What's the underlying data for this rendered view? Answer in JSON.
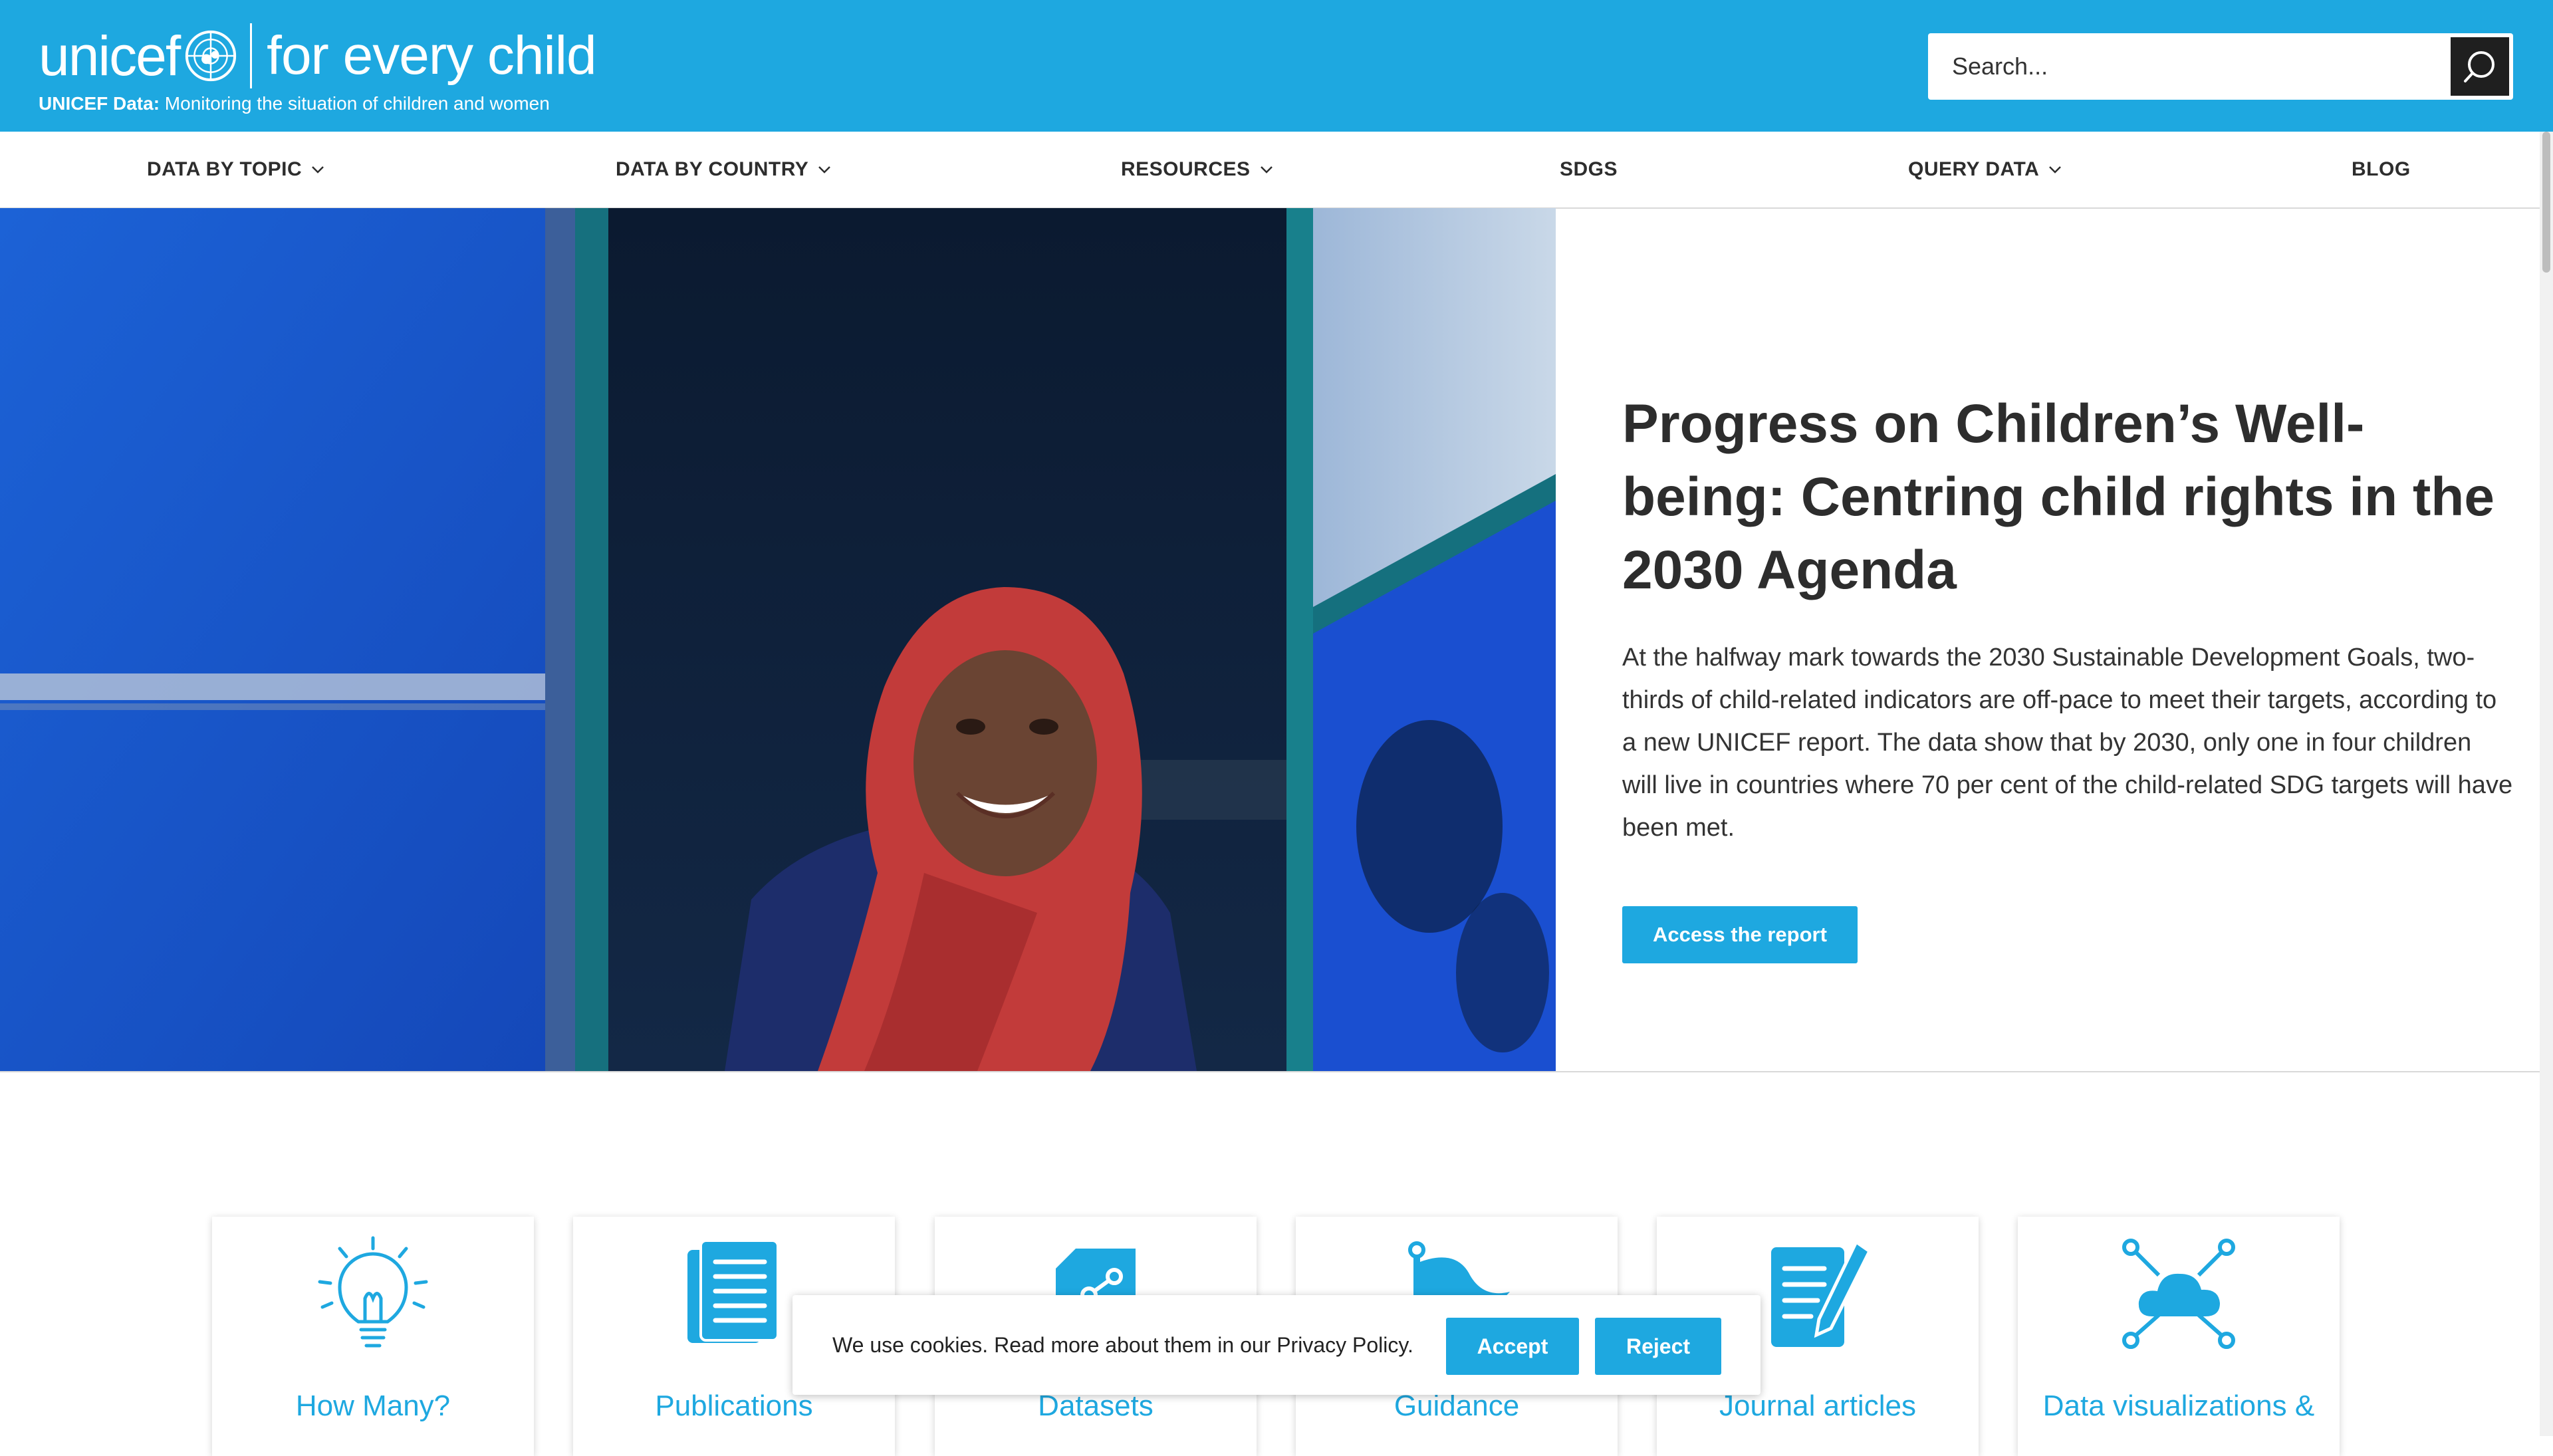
{
  "colors": {
    "brand_blue": "#1ea8e0",
    "text_dark": "#2d2d2d",
    "search_button": "#1f1f1f"
  },
  "header": {
    "logo_word": "unicef",
    "logo_tagline": "for every child",
    "subtitle_bold": "UNICEF Data:",
    "subtitle_rest": "Monitoring the situation of children and women"
  },
  "search": {
    "placeholder": "Search...",
    "button_icon": "search-icon"
  },
  "nav": [
    {
      "label": "DATA BY TOPIC",
      "dropdown": true
    },
    {
      "label": "DATA BY COUNTRY",
      "dropdown": true
    },
    {
      "label": "RESOURCES",
      "dropdown": true
    },
    {
      "label": "SDGS",
      "dropdown": false
    },
    {
      "label": "QUERY DATA",
      "dropdown": true
    },
    {
      "label": "BLOG",
      "dropdown": false
    }
  ],
  "hero": {
    "title": "Progress on Children’s Well-being: Centring child rights in the 2030 Agenda",
    "body": "At the halfway mark towards the 2030 Sustainable Development Goals, two-thirds of child-related indicators are off-pace to meet their targets, according to a new UNICEF report. The data show that by 2030, only one in four children will live in countries where 70 per cent of the child-related SDG targets will have been met.",
    "cta": "Access the report"
  },
  "cards": [
    {
      "label": "How Many?",
      "icon": "lightbulb-icon"
    },
    {
      "label": "Publications",
      "icon": "document-list-icon"
    },
    {
      "label": "Datasets",
      "icon": "share-file-icon"
    },
    {
      "label": "Guidance",
      "icon": "flag-icon"
    },
    {
      "label": "Journal articles",
      "icon": "pencil-document-icon"
    },
    {
      "label": "Data visualizations &",
      "icon": "cloud-network-icon"
    }
  ],
  "cookie": {
    "text": "We use cookies. Read more about them in our Privacy Policy.",
    "accept": "Accept",
    "reject": "Reject"
  }
}
